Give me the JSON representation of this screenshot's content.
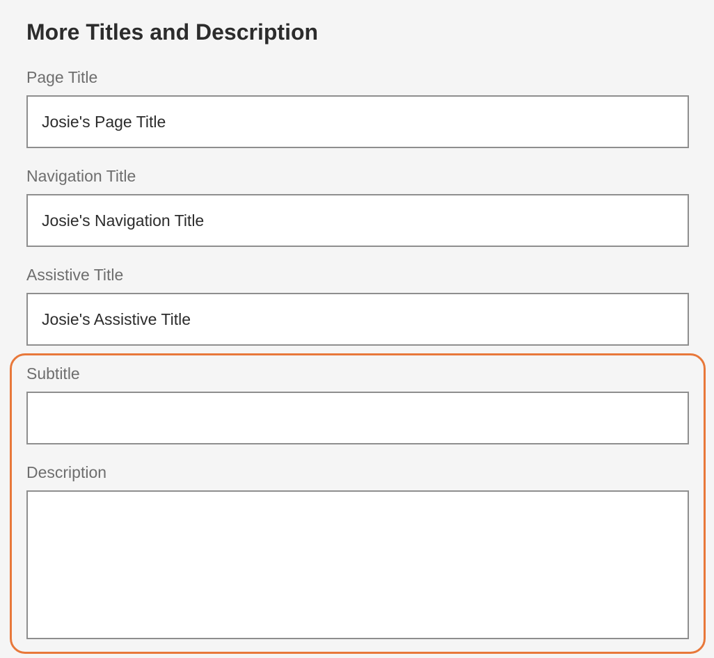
{
  "section": {
    "title": "More Titles and Description"
  },
  "fields": {
    "page_title": {
      "label": "Page Title",
      "value": "Josie's Page Title"
    },
    "navigation_title": {
      "label": "Navigation Title",
      "value": "Josie's Navigation Title"
    },
    "assistive_title": {
      "label": "Assistive Title",
      "value": "Josie's Assistive Title"
    },
    "subtitle": {
      "label": "Subtitle",
      "value": ""
    },
    "description": {
      "label": "Description",
      "value": ""
    }
  },
  "colors": {
    "background": "#f5f5f5",
    "input_border": "#8e8e8e",
    "label": "#6e6e6e",
    "highlight": "#e8783a"
  }
}
